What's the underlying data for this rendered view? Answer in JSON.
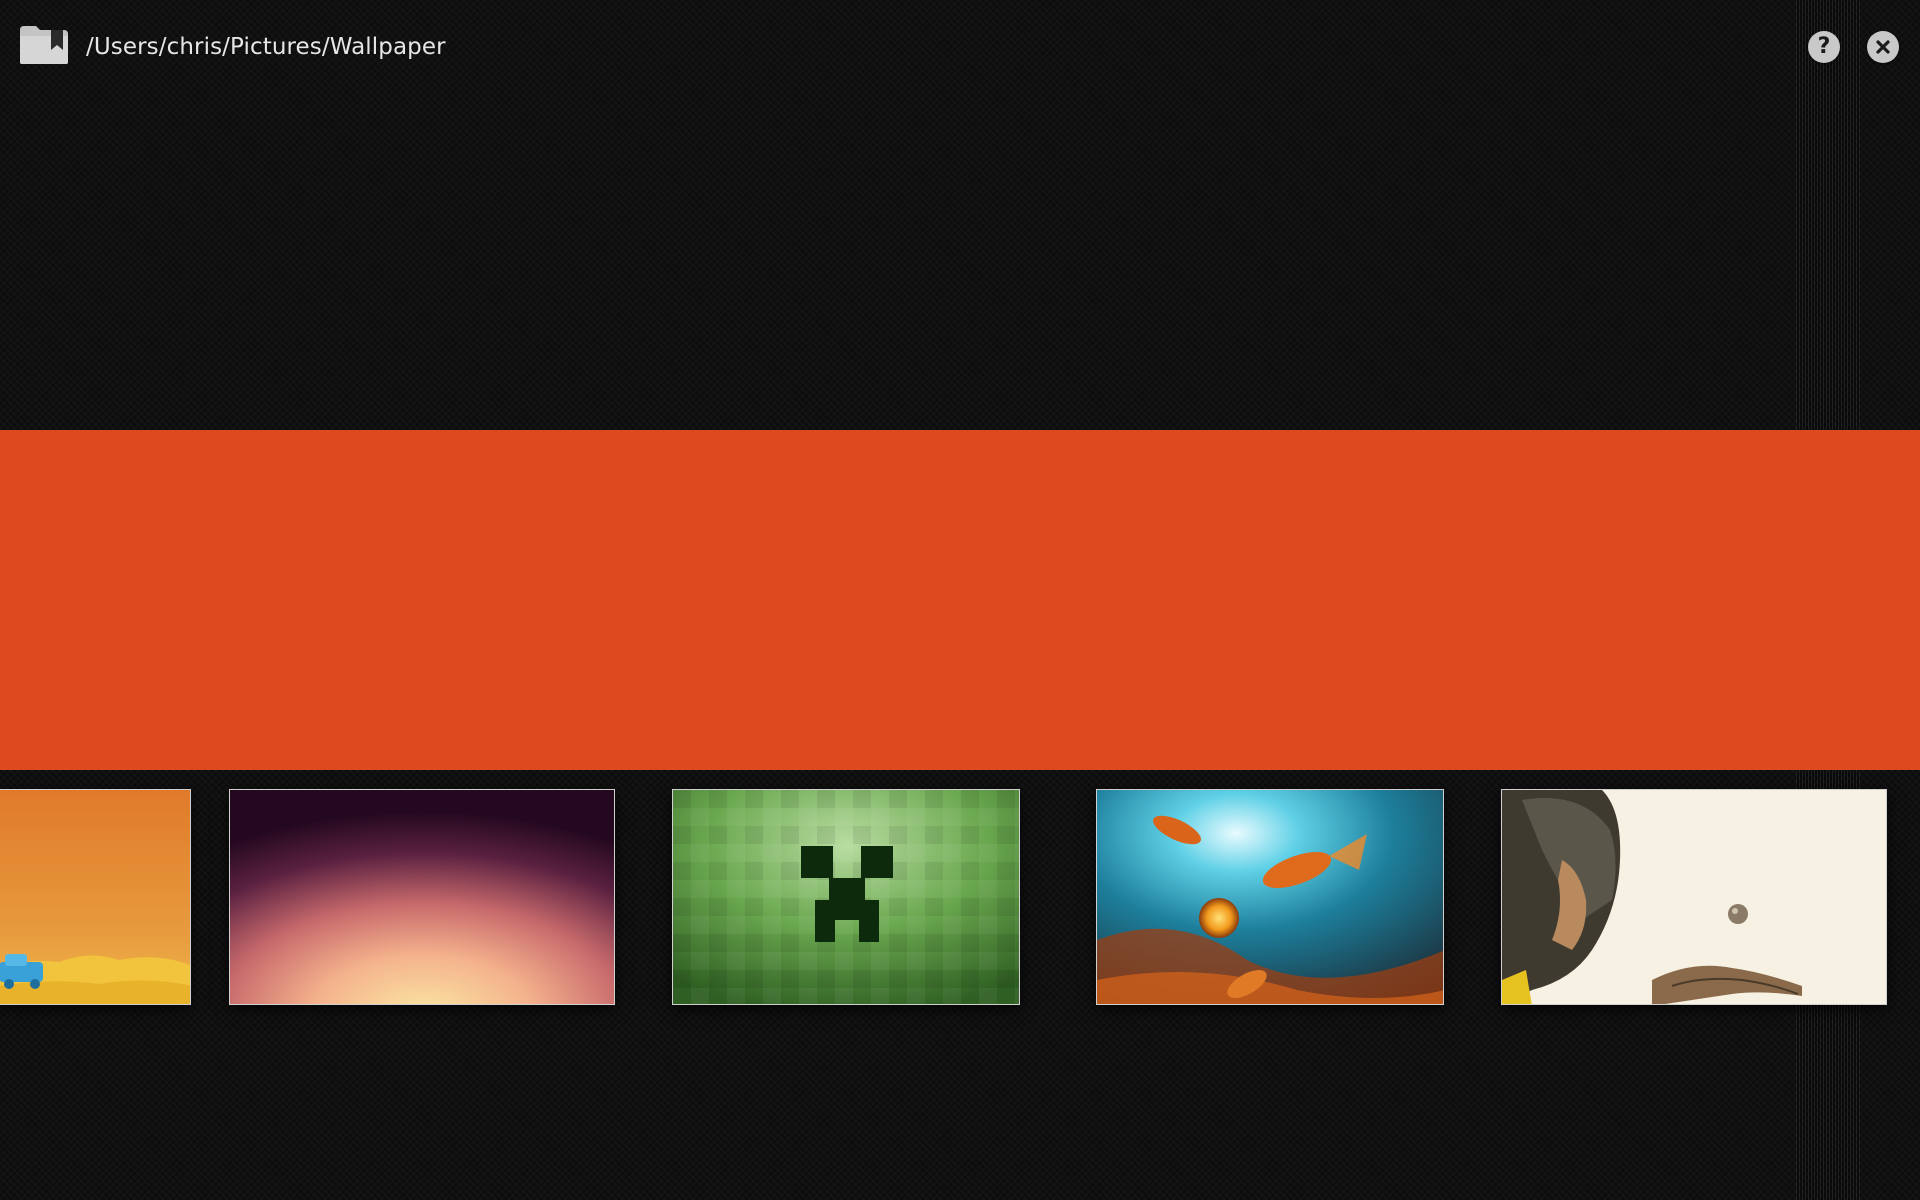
{
  "header": {
    "folder_icon": "folder-bookmark-icon",
    "path": "/Users/chris/Pictures/Wallpaper",
    "help_label": "?",
    "help_icon": "help-icon",
    "close_icon": "close-icon"
  },
  "preview": {
    "color": "#dd4a1f"
  },
  "thumbnails": [
    {
      "subject": "orange desert with blue car",
      "colors": [
        "#e0782a",
        "#f0c94a",
        "#3aa0d8"
      ]
    },
    {
      "subject": "purple to peach gradient",
      "colors": [
        "#2a0a24",
        "#e98a7a",
        "#f8e4a0"
      ]
    },
    {
      "subject": "green creeper face",
      "colors": [
        "#6aa84f",
        "#3d7a2a",
        "#0e2a0c"
      ]
    },
    {
      "subject": "goldfish underwater painting",
      "colors": [
        "#29b6cf",
        "#d96a1c",
        "#2a3d4a"
      ]
    },
    {
      "subject": "helmeted figure with coin",
      "colors": [
        "#f7f2e3",
        "#4a3a2a",
        "#e6c21f"
      ]
    }
  ]
}
